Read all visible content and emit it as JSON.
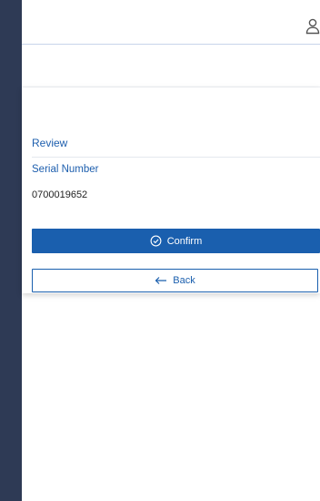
{
  "header": {
    "user_icon": "user-icon"
  },
  "review": {
    "title": "Review",
    "serial_label": "Serial Number",
    "serial_value": "0700019652"
  },
  "actions": {
    "confirm_label": "Confirm",
    "confirm_icon": "check-circle-icon",
    "back_label": "Back",
    "back_icon": "arrow-left-icon"
  },
  "colors": {
    "sidebar_bg": "#2e3a55",
    "accent": "#1a5fae",
    "text_link": "#1e5fae"
  }
}
